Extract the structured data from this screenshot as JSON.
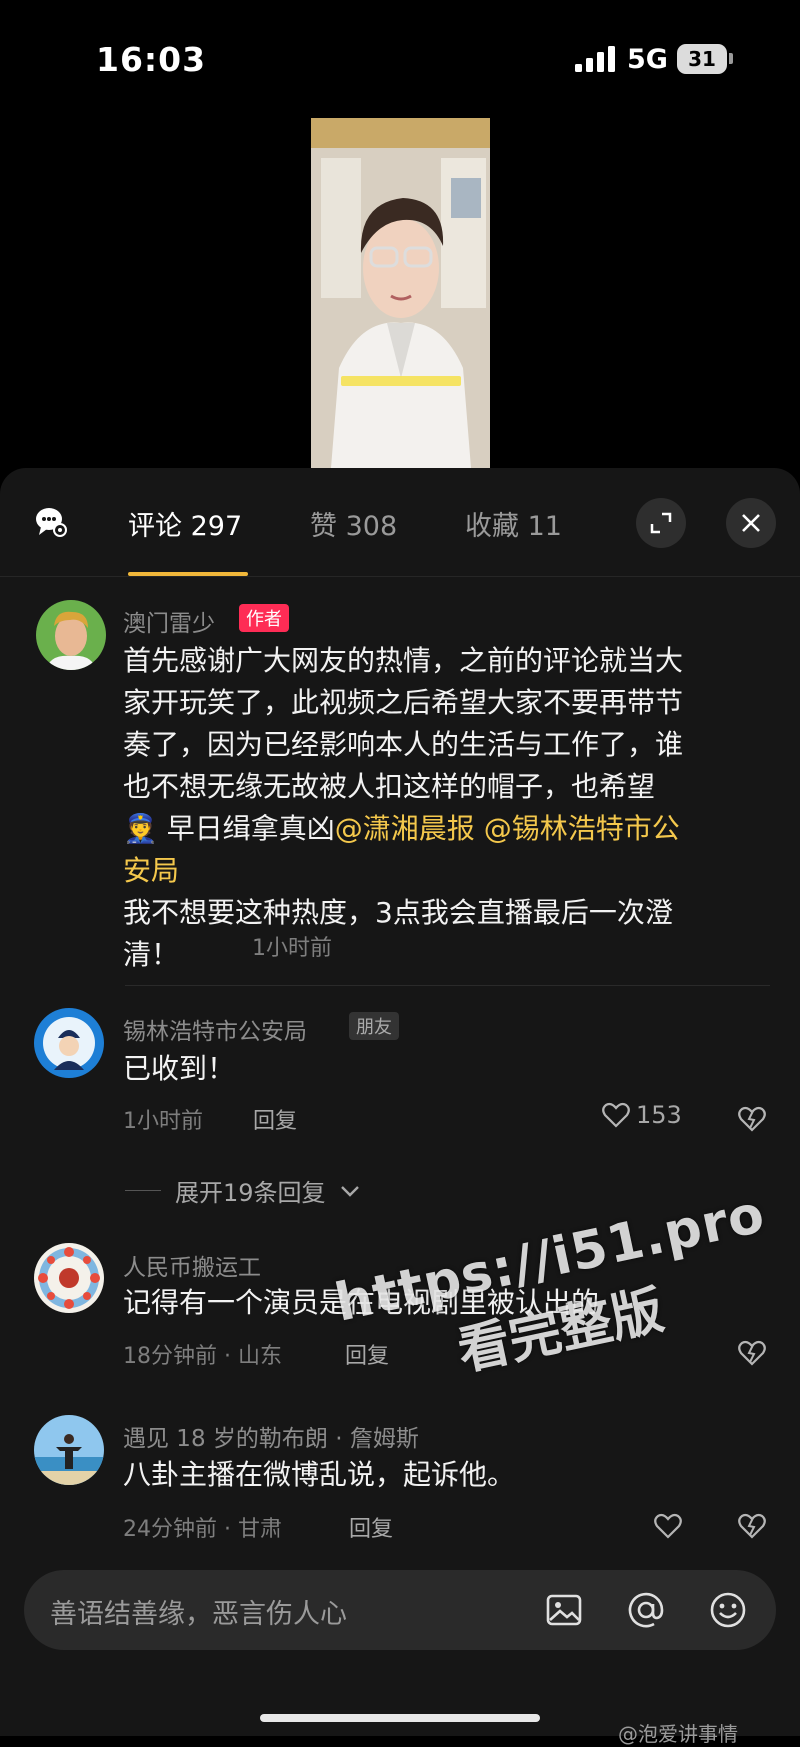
{
  "status_bar": {
    "time": "16:03",
    "network": "5G",
    "battery": "31"
  },
  "tabs": {
    "comments": "评论 297",
    "likes": "赞 308",
    "favorites": "收藏 11"
  },
  "comments": [
    {
      "user": "澳门雷少",
      "badge": "作者",
      "text_parts": [
        "首先感谢广大网友的热情，之前的评论就当大家开玩笑了，此视频之后希望大家不要再带节奏了，因为已经影响本人的生活与工作了，谁也不想无缘无故被人扣这样的帽子，也希望",
        "👮",
        " 早日缉拿真凶",
        "@潇湘晨报",
        " ",
        "@锡林浩特市公安局"
      ],
      "text_line2": "我不想要这种热度，3点我会直播最后一次澄清！",
      "time": "1小时前"
    },
    {
      "user": "锡林浩特市公安局",
      "badge": "朋友",
      "text": "已收到！",
      "time": "1小时前",
      "reply": "回复",
      "likes": "153"
    },
    {
      "user": "人民币搬运工",
      "text": "记得有一个演员是在电视剧里被认出的",
      "time": "18分钟前 · 山东",
      "reply": "回复"
    },
    {
      "user": "遇见 18 岁的勒布朗 · 詹姆斯",
      "text": "八卦主播在微博乱说，起诉他。",
      "time": "24分钟前 · 甘肃",
      "reply": "回复"
    }
  ],
  "expand_replies": "展开19条回复",
  "watermark": {
    "line1": "https://i51.pro",
    "line2": "看完整版"
  },
  "input": {
    "placeholder": "善语结善缘，恶言伤人心"
  },
  "credit": "@泡爱讲事情"
}
